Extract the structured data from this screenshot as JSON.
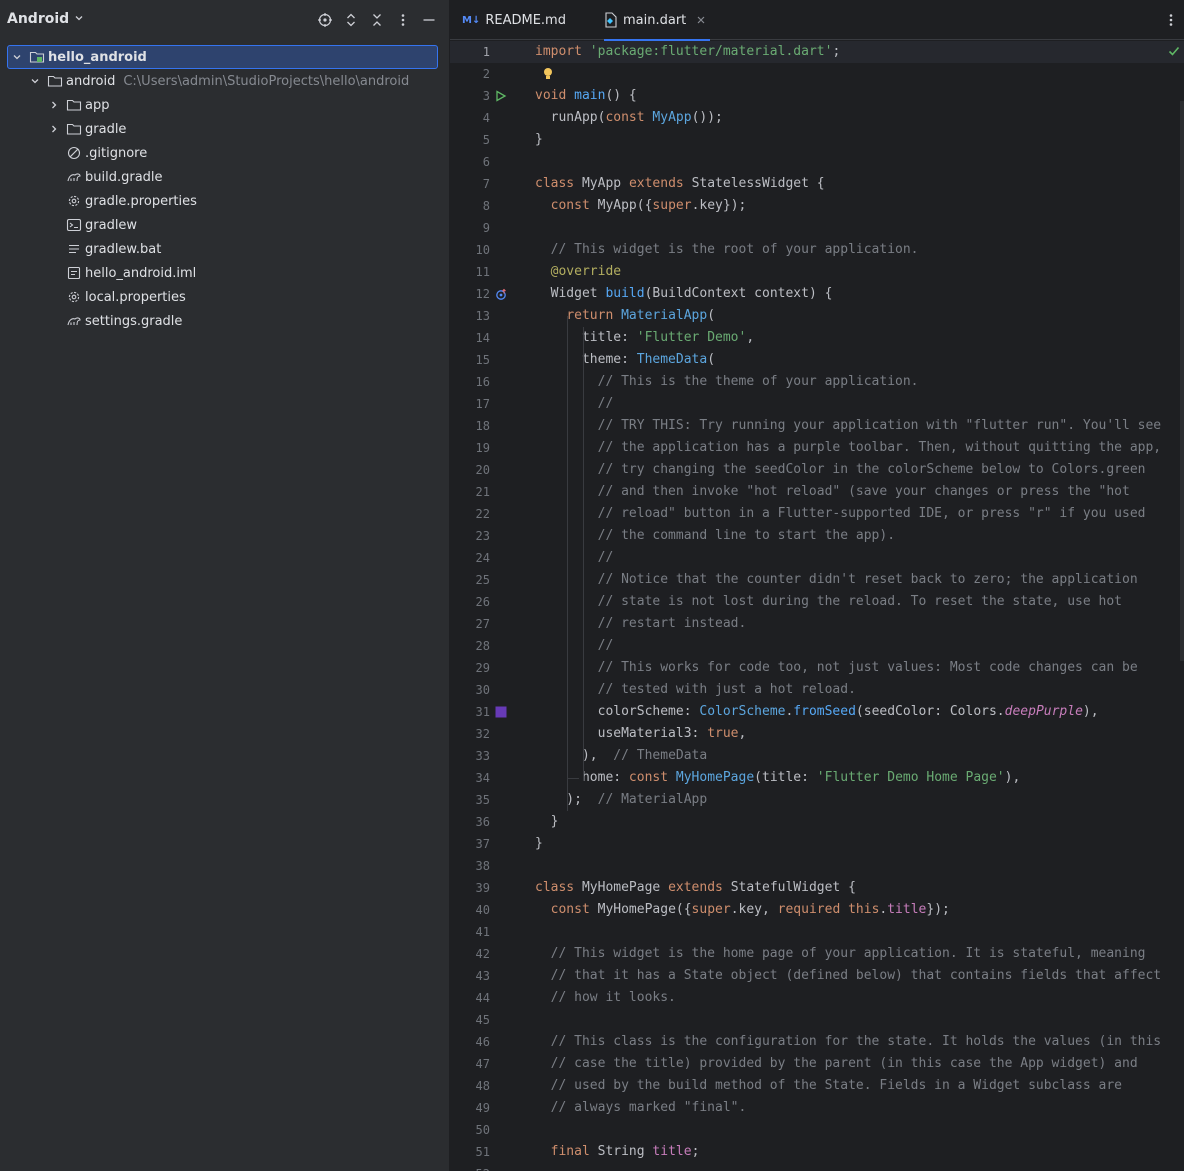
{
  "project_panel": {
    "title": "Android",
    "tree": [
      {
        "label": "hello_android",
        "path": "",
        "depth": 0,
        "expanded": true,
        "selected": true,
        "icon": "module-folder-icon"
      },
      {
        "label": "android",
        "path": "C:\\Users\\admin\\StudioProjects\\hello\\android",
        "depth": 1,
        "expanded": true,
        "selected": false,
        "icon": "folder-icon"
      },
      {
        "label": "app",
        "path": "",
        "depth": 2,
        "expanded": false,
        "selected": false,
        "icon": "folder-icon"
      },
      {
        "label": "gradle",
        "path": "",
        "depth": 2,
        "expanded": false,
        "selected": false,
        "icon": "folder-icon"
      },
      {
        "label": ".gitignore",
        "path": "",
        "depth": 2,
        "leaf": true,
        "icon": "ignore-file-icon"
      },
      {
        "label": "build.gradle",
        "path": "",
        "depth": 2,
        "leaf": true,
        "icon": "gradle-icon"
      },
      {
        "label": "gradle.properties",
        "path": "",
        "depth": 2,
        "leaf": true,
        "icon": "settings-gear-icon"
      },
      {
        "label": "gradlew",
        "path": "",
        "depth": 2,
        "leaf": true,
        "icon": "terminal-icon"
      },
      {
        "label": "gradlew.bat",
        "path": "",
        "depth": 2,
        "leaf": true,
        "icon": "text-file-icon"
      },
      {
        "label": "hello_android.iml",
        "path": "",
        "depth": 2,
        "leaf": true,
        "icon": "iml-file-icon"
      },
      {
        "label": "local.properties",
        "path": "",
        "depth": 2,
        "leaf": true,
        "icon": "settings-gear-icon"
      },
      {
        "label": "settings.gradle",
        "path": "",
        "depth": 2,
        "leaf": true,
        "icon": "gradle-icon"
      }
    ]
  },
  "tabs": [
    {
      "label": "README.md",
      "icon": "markdown-icon",
      "active": false
    },
    {
      "label": "main.dart",
      "icon": "dart-file-icon",
      "active": true
    }
  ],
  "editor": {
    "lines": [
      [
        [
          "k",
          "import "
        ],
        [
          "s",
          "'package:flutter/material.dart'"
        ],
        [
          "",
          "; "
        ]
      ],
      [],
      [
        [
          "k",
          "void "
        ],
        [
          "f",
          "main"
        ],
        [
          "",
          "() {"
        ]
      ],
      [
        [
          "",
          "  runApp("
        ],
        [
          "k",
          "const "
        ],
        [
          "t",
          "MyApp"
        ],
        [
          "",
          "());"
        ]
      ],
      [
        [
          "",
          "}"
        ]
      ],
      [],
      [
        [
          "k",
          "class "
        ],
        [
          "",
          "MyApp "
        ],
        [
          "k",
          "extends "
        ],
        [
          "",
          "StatelessWidget {"
        ]
      ],
      [
        [
          "",
          "  "
        ],
        [
          "k",
          "const "
        ],
        [
          "",
          "MyApp({"
        ],
        [
          "k",
          "super"
        ],
        [
          "",
          ".key});"
        ]
      ],
      [],
      [
        [
          "c",
          "  // This widget is the root of your application."
        ]
      ],
      [
        [
          "ann",
          "  @override"
        ]
      ],
      [
        [
          "",
          "  Widget "
        ],
        [
          "f",
          "build"
        ],
        [
          "",
          "(BuildContext context) {"
        ]
      ],
      [
        [
          "",
          "    "
        ],
        [
          "k",
          "return "
        ],
        [
          "t",
          "MaterialApp"
        ],
        [
          "",
          "("
        ]
      ],
      [
        [
          "",
          "      title: "
        ],
        [
          "s",
          "'Flutter Demo'"
        ],
        [
          "",
          ","
        ]
      ],
      [
        [
          "",
          "      theme: "
        ],
        [
          "t",
          "ThemeData"
        ],
        [
          "",
          "("
        ]
      ],
      [
        [
          "c",
          "        // This is the theme of your application."
        ]
      ],
      [
        [
          "c",
          "        //"
        ]
      ],
      [
        [
          "c",
          "        // TRY THIS: Try running your application with \"flutter run\". You'll see"
        ]
      ],
      [
        [
          "c",
          "        // the application has a purple toolbar. Then, without quitting the app,"
        ]
      ],
      [
        [
          "c",
          "        // try changing the seedColor in the colorScheme below to Colors.green"
        ]
      ],
      [
        [
          "c",
          "        // and then invoke \"hot reload\" (save your changes or press the \"hot"
        ]
      ],
      [
        [
          "c",
          "        // reload\" button in a Flutter-supported IDE, or press \"r\" if you used"
        ]
      ],
      [
        [
          "c",
          "        // the command line to start the app)."
        ]
      ],
      [
        [
          "c",
          "        //"
        ]
      ],
      [
        [
          "c",
          "        // Notice that the counter didn't reset back to zero; the application"
        ]
      ],
      [
        [
          "c",
          "        // state is not lost during the reload. To reset the state, use hot"
        ]
      ],
      [
        [
          "c",
          "        // restart instead."
        ]
      ],
      [
        [
          "c",
          "        //"
        ]
      ],
      [
        [
          "c",
          "        // This works for code too, not just values: Most code changes can be"
        ]
      ],
      [
        [
          "c",
          "        // tested with just a hot reload."
        ]
      ],
      [
        [
          "",
          "        colorScheme: "
        ],
        [
          "t",
          "ColorScheme"
        ],
        [
          "",
          "."
        ],
        [
          "f",
          "fromSeed"
        ],
        [
          "",
          "(seedColor: Colors."
        ],
        [
          "it",
          "deepPurple"
        ],
        [
          "",
          "),"
        ]
      ],
      [
        [
          "",
          "        useMaterial3: "
        ],
        [
          "k",
          "true"
        ],
        [
          "",
          ","
        ]
      ],
      [
        [
          "",
          "      ),  "
        ],
        [
          "hint",
          "// ThemeData"
        ]
      ],
      [
        [
          "",
          "      home: "
        ],
        [
          "k",
          "const "
        ],
        [
          "t",
          "MyHomePage"
        ],
        [
          "",
          "(title: "
        ],
        [
          "s",
          "'Flutter Demo Home Page'"
        ],
        [
          "",
          "),"
        ]
      ],
      [
        [
          "",
          "    );  "
        ],
        [
          "hint",
          "// MaterialApp"
        ]
      ],
      [
        [
          "",
          "  }"
        ]
      ],
      [
        [
          "",
          "}"
        ]
      ],
      [],
      [
        [
          "k",
          "class "
        ],
        [
          "",
          "MyHomePage "
        ],
        [
          "k",
          "extends "
        ],
        [
          "",
          "StatefulWidget {"
        ]
      ],
      [
        [
          "",
          "  "
        ],
        [
          "k",
          "const "
        ],
        [
          "",
          "MyHomePage({"
        ],
        [
          "k",
          "super"
        ],
        [
          "",
          ".key, "
        ],
        [
          "k",
          "required this"
        ],
        [
          "",
          "."
        ],
        [
          "p",
          "title"
        ],
        [
          "",
          "});"
        ]
      ],
      [],
      [
        [
          "c",
          "  // This widget is the home page of your application. It is stateful, meaning"
        ]
      ],
      [
        [
          "c",
          "  // that it has a State object (defined below) that contains fields that affect"
        ]
      ],
      [
        [
          "c",
          "  // how it looks."
        ]
      ],
      [],
      [
        [
          "c",
          "  // This class is the configuration for the state. It holds the values (in this"
        ]
      ],
      [
        [
          "c",
          "  // case the title) provided by the parent (in this case the App widget) and"
        ]
      ],
      [
        [
          "c",
          "  // used by the build method of the State. Fields in a Widget subclass are"
        ]
      ],
      [
        [
          "c",
          "  // always marked \"final\"."
        ]
      ],
      [],
      [
        [
          "k",
          "  final "
        ],
        [
          "",
          "String "
        ],
        [
          "p",
          "title"
        ],
        [
          "",
          ";"
        ]
      ],
      []
    ],
    "gutter_icons": {
      "3": "run-icon",
      "12": "override-icon",
      "31": "color-swatch-icon"
    },
    "swatch_color": "#673ab7"
  },
  "colors": {
    "accent": "#3574f0",
    "check": "#5fb865"
  }
}
